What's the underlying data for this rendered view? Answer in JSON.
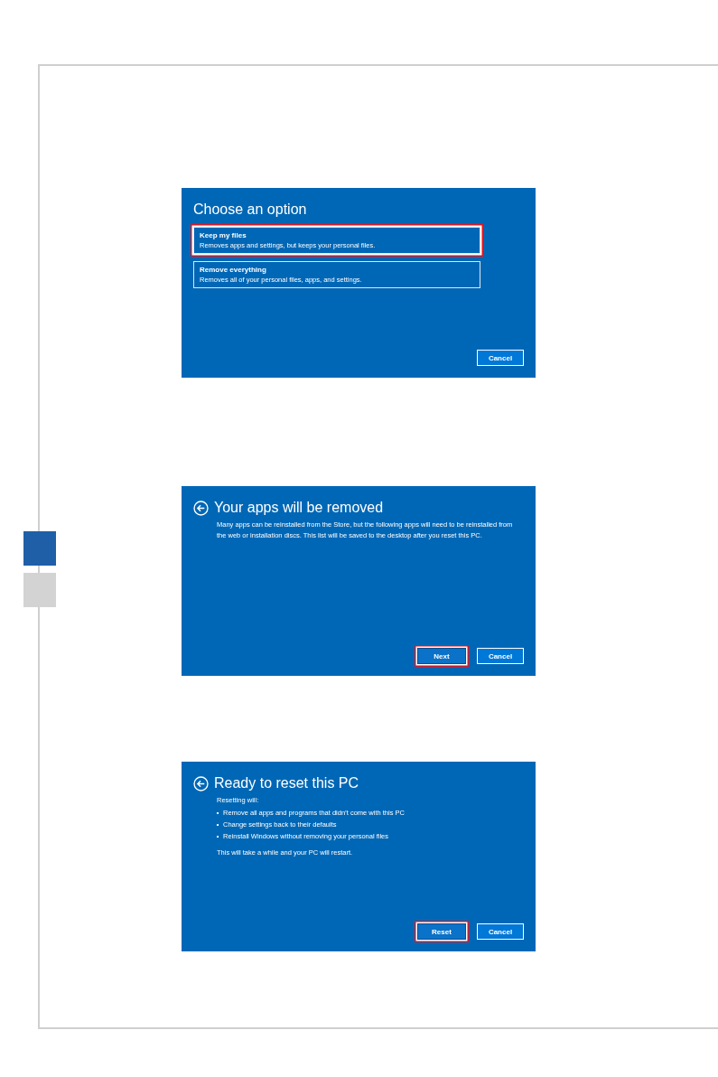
{
  "side_tabs": [
    {
      "selected": true
    },
    {
      "selected": false
    }
  ],
  "dialogs": [
    {
      "title": "Choose an option",
      "back_button": false,
      "options": [
        {
          "title": "Keep my files",
          "description": "Removes apps and settings, but keeps your personal files.",
          "highlighted": true
        },
        {
          "title": "Remove everything",
          "description": "Removes all of your personal files, apps, and settings.",
          "highlighted": false
        }
      ],
      "buttons": [
        {
          "label": "Cancel",
          "highlighted": false
        }
      ]
    },
    {
      "title": "Your apps will be removed",
      "back_button": true,
      "body": [
        {
          "kind": "text",
          "text": "Many apps can be reinstalled from the Store, but the following apps will need to be reinstalled from the web or installation discs. This list will be saved to the desktop after you reset this PC."
        }
      ],
      "buttons": [
        {
          "label": "Next",
          "highlighted": true
        },
        {
          "label": "Cancel",
          "highlighted": false
        }
      ]
    },
    {
      "title": "Ready to reset this PC",
      "back_button": true,
      "body": [
        {
          "kind": "text",
          "text": "Resetting will:"
        },
        {
          "kind": "bullet",
          "text": "Remove all apps and programs that didn’t come with this PC"
        },
        {
          "kind": "bullet",
          "text": "Change settings back to their defaults"
        },
        {
          "kind": "bullet",
          "text": "Reinstall Windows without removing your personal files"
        },
        {
          "kind": "gap_text",
          "text": "This will take a while and your PC will restart."
        }
      ],
      "buttons": [
        {
          "label": "Reset",
          "highlighted": true
        },
        {
          "label": "Cancel",
          "highlighted": false
        }
      ]
    }
  ]
}
